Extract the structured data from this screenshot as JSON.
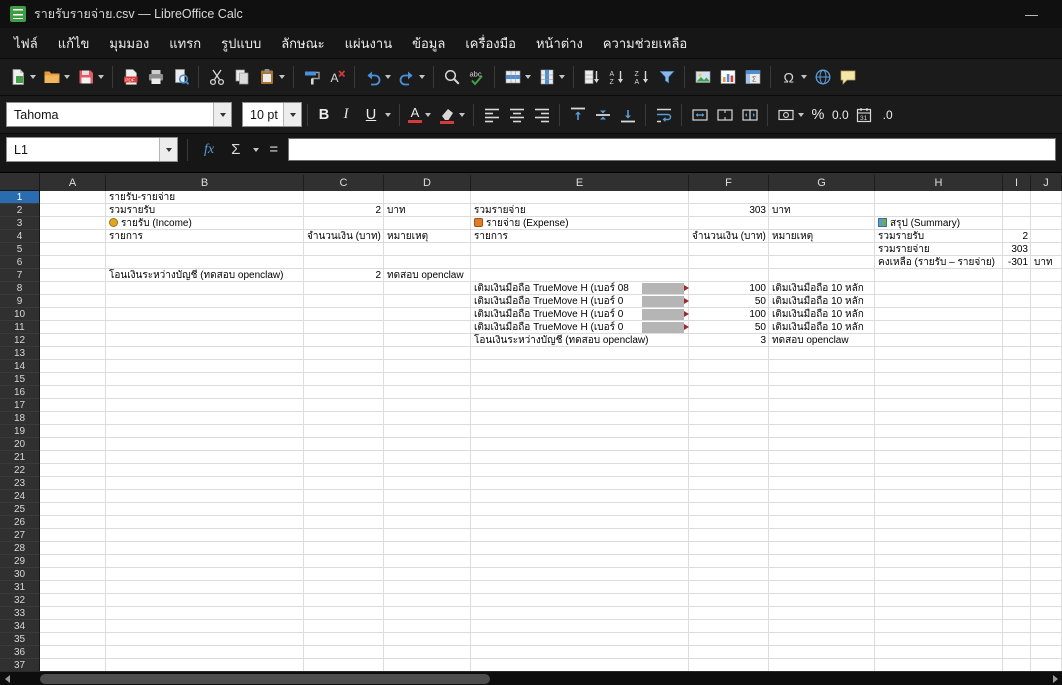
{
  "window": {
    "title": "รายรับรายจ่าย.csv — LibreOffice Calc",
    "minimize_glyph": "—"
  },
  "menubar": {
    "items": [
      "ไฟล์",
      "แก้ไข",
      "มุมมอง",
      "แทรก",
      "รูปแบบ",
      "ลักษณะ",
      "แผ่นงาน",
      "ข้อมูล",
      "เครื่องมือ",
      "หน้าต่าง",
      "ความช่วยเหลือ"
    ]
  },
  "toolbar": {
    "groups": [
      [
        "new-document",
        "open",
        "save"
      ],
      [
        "export-pdf",
        "print",
        "print-preview"
      ],
      [
        "cut",
        "copy",
        "paste"
      ],
      [
        "clone-formatting",
        "clear-formatting"
      ],
      [
        "undo",
        "redo"
      ],
      [
        "find-and-replace",
        "spelling"
      ],
      [
        "insert-row",
        "insert-column"
      ],
      [
        "sort",
        "sort-ascending",
        "sort-descending",
        "autofilter"
      ],
      [
        "insert-image",
        "insert-chart",
        "pivot-table"
      ],
      [
        "special-character",
        "hyperlink",
        "comment"
      ]
    ],
    "dropdowns": [
      "new-document",
      "open",
      "save",
      "paste",
      "undo",
      "redo",
      "insert-row",
      "insert-column",
      "special-character"
    ]
  },
  "formatbar": {
    "font_name": "Tahoma",
    "font_size": "10 pt",
    "bold": "B",
    "italic": "I",
    "underline": "U",
    "font_color_glyph": "A",
    "percent": "%",
    "number_format": "0.0",
    "add_decimal": ".0"
  },
  "formulabar": {
    "cell_reference": "L1",
    "fx": "fx",
    "sum": "Σ",
    "equals": "=",
    "input_value": ""
  },
  "grid": {
    "selected_row": 1,
    "columns": [
      "A",
      "B",
      "C",
      "D",
      "E",
      "F",
      "G",
      "H",
      "I",
      "J"
    ],
    "row_count": 37,
    "cells": [
      {
        "r": 1,
        "c": "B",
        "t": "รายรับ-รายจ่าย"
      },
      {
        "r": 2,
        "c": "B",
        "t": "รวมรายรับ"
      },
      {
        "r": 2,
        "c": "C",
        "t": "2",
        "a": "r"
      },
      {
        "r": 2,
        "c": "D",
        "t": "บาท"
      },
      {
        "r": 2,
        "c": "E",
        "t": "รวมรายจ่าย"
      },
      {
        "r": 2,
        "c": "F",
        "t": "303",
        "a": "r"
      },
      {
        "r": 2,
        "c": "G",
        "t": "บาท"
      },
      {
        "r": 3,
        "c": "B",
        "t": "รายรับ (Income)",
        "icon": "income"
      },
      {
        "r": 3,
        "c": "E",
        "t": "รายจ่าย (Expense)",
        "icon": "expense"
      },
      {
        "r": 3,
        "c": "H",
        "t": "สรุป (Summary)",
        "icon": "summary"
      },
      {
        "r": 4,
        "c": "B",
        "t": "รายการ"
      },
      {
        "r": 4,
        "c": "C",
        "t": "จำนวนเงิน (บาท)"
      },
      {
        "r": 4,
        "c": "D",
        "t": "หมายเหตุ"
      },
      {
        "r": 4,
        "c": "E",
        "t": "รายการ"
      },
      {
        "r": 4,
        "c": "F",
        "t": "จำนวนเงิน (บาท)"
      },
      {
        "r": 4,
        "c": "G",
        "t": "หมายเหตุ"
      },
      {
        "r": 4,
        "c": "H",
        "t": "รวมรายรับ"
      },
      {
        "r": 4,
        "c": "I",
        "t": "2",
        "a": "r"
      },
      {
        "r": 5,
        "c": "H",
        "t": "รวมรายจ่าย"
      },
      {
        "r": 5,
        "c": "I",
        "t": "303",
        "a": "r"
      },
      {
        "r": 6,
        "c": "H",
        "t": "คงเหลือ (รายรับ – รายจ่าย)"
      },
      {
        "r": 6,
        "c": "I",
        "t": "-301",
        "a": "r"
      },
      {
        "r": 6,
        "c": "J",
        "t": "บาท"
      },
      {
        "r": 7,
        "c": "B",
        "t": "โอนเงินระหว่างบัญชี (ทดสอบ openclaw)"
      },
      {
        "r": 7,
        "c": "C",
        "t": "2",
        "a": "r"
      },
      {
        "r": 7,
        "c": "D",
        "t": "ทดสอบ openclaw"
      },
      {
        "r": 8,
        "c": "E",
        "t": "เติมเงินมือถือ TrueMove H (เบอร์ 08",
        "redacted": true,
        "overflow": true
      },
      {
        "r": 8,
        "c": "F",
        "t": "100",
        "a": "r"
      },
      {
        "r": 8,
        "c": "G",
        "t": "เติมเงินมือถือ 10 หลัก"
      },
      {
        "r": 9,
        "c": "E",
        "t": "เติมเงินมือถือ TrueMove H (เบอร์ 0",
        "redacted": true,
        "overflow": true
      },
      {
        "r": 9,
        "c": "F",
        "t": "50",
        "a": "r"
      },
      {
        "r": 9,
        "c": "G",
        "t": "เติมเงินมือถือ 10 หลัก"
      },
      {
        "r": 10,
        "c": "E",
        "t": "เติมเงินมือถือ TrueMove H (เบอร์ 0",
        "redacted": true,
        "overflow": true
      },
      {
        "r": 10,
        "c": "F",
        "t": "100",
        "a": "r"
      },
      {
        "r": 10,
        "c": "G",
        "t": "เติมเงินมือถือ 10 หลัก"
      },
      {
        "r": 11,
        "c": "E",
        "t": "เติมเงินมือถือ TrueMove H (เบอร์ 0",
        "redacted": true,
        "overflow": true
      },
      {
        "r": 11,
        "c": "F",
        "t": "50",
        "a": "r"
      },
      {
        "r": 11,
        "c": "G",
        "t": "เติมเงินมือถือ 10 หลัก"
      },
      {
        "r": 12,
        "c": "E",
        "t": "โอนเงินระหว่างบัญชี (ทดสอบ openclaw)"
      },
      {
        "r": 12,
        "c": "F",
        "t": "3",
        "a": "r"
      },
      {
        "r": 12,
        "c": "G",
        "t": "ทดสอบ openclaw"
      }
    ]
  },
  "colors": {
    "selection_accent": "#2a6cb0",
    "grid_line": "#dcdcdc",
    "header_bg": "#303030",
    "redaction_gray": "#b5b5b5",
    "overflow_marker": "#9b2c2c"
  }
}
